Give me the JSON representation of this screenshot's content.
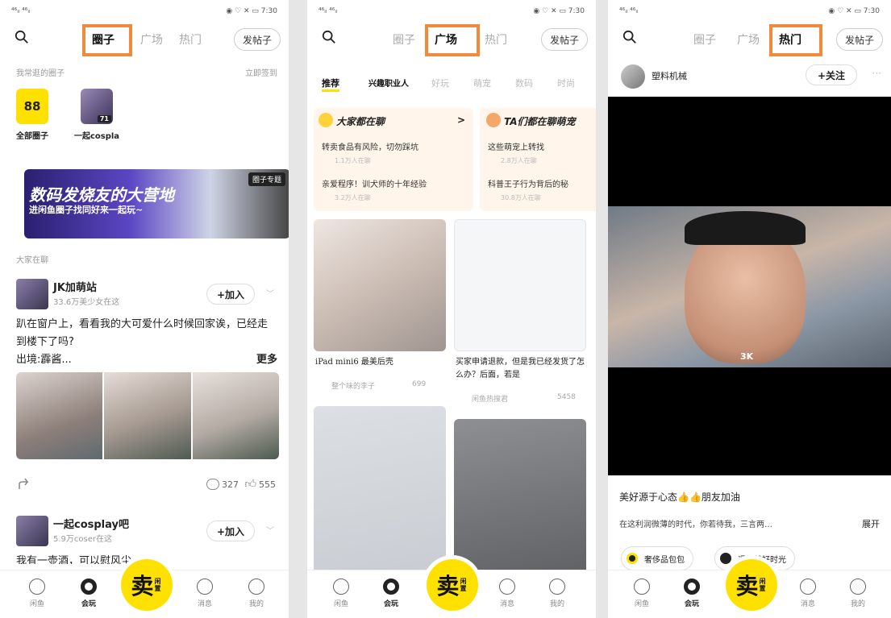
{
  "status": {
    "left": "⁴⁶ᵢₗ ⁴⁶ᵢₗ",
    "right": "◉ ♡ ✕ ▭ 7:30"
  },
  "tabs": {
    "circles": "圈子",
    "square": "广场",
    "hot": "热门",
    "post": "发帖子"
  },
  "nav": {
    "home": "闲鱼",
    "play": "会玩",
    "sell": "卖",
    "sell_sub": "闲置",
    "messages": "消息",
    "me": "我的"
  },
  "p1": {
    "my_circles": "我常逛的圈子",
    "checkin": "立即签到",
    "circles": [
      {
        "label": "全部圈子",
        "icon": "88"
      },
      {
        "label": "一起cospla",
        "badge": "71"
      }
    ],
    "banner": {
      "line1": "数码发烧友的大营地",
      "line2": "进闲鱼圈子找同好来一起玩~",
      "tag": "圈子专题"
    },
    "chatting": "大家在聊",
    "group1": {
      "name": "JK加萌站",
      "sub": "33.6万美少女在这",
      "join": "+加入"
    },
    "post_text": "趴在窗户上，看看我的大可爱什么时候回家诶，已经走到楼下了吗?",
    "post_extra": "出境:霹酱...",
    "more": "更多",
    "comments": "327",
    "likes": "555",
    "group2": {
      "name": "一起cosplay吧",
      "sub": "5.9万coser在这",
      "join": "+加入"
    },
    "cut_text": "我有一壶酒，可以慰风尘"
  },
  "p2": {
    "subtabs": [
      "推荐",
      "兴趣职业人",
      "好玩",
      "萌宠",
      "数码",
      "时尚"
    ],
    "card1": {
      "title": "大家都在聊",
      "arrow": ">",
      "l1": "转卖食品有风险，切勿踩坑",
      "s1": "1.1万人在聊",
      "l2": "亲爱程序！训犬师的十年经验",
      "s2": "3.2万人在聊"
    },
    "card2": {
      "title": "TA们都在聊萌宠",
      "l1": "这些萌宠上转找",
      "s1": "2.8万人在聊",
      "l2": "科普王子行为背后的秘",
      "s2": "30.8万人在聊"
    },
    "item1": {
      "caption": "iPad mini6 最美后壳",
      "user": "整个味的李子",
      "likes": "699"
    },
    "item2": {
      "caption": "买家申请退款，但是我已经发货了怎么办？后面，若是",
      "user": "闲鱼热搜君",
      "likes": "5458"
    }
  },
  "p3": {
    "user": "塑料机械",
    "follow": "+关注",
    "dots": "···",
    "badge": "3K",
    "title": "美好源于心态👍👍朋友加油",
    "desc": "在这利润微薄的时代，你若待我，三言两…",
    "expand": "展开",
    "tags": [
      "奢侈品包包",
      "遇见美好时光"
    ]
  }
}
